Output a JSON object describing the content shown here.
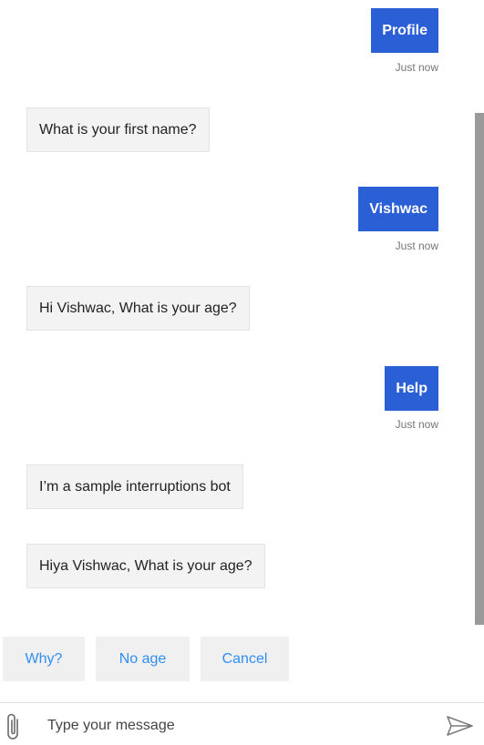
{
  "transcript": {
    "messages": [
      {
        "from": "user",
        "text": "Profile",
        "timestamp": "Just now"
      },
      {
        "from": "bot",
        "text": "What is your first name?"
      },
      {
        "from": "user",
        "text": "Vishwac",
        "timestamp": "Just now"
      },
      {
        "from": "bot",
        "text": "Hi Vishwac, What is your age?"
      },
      {
        "from": "user",
        "text": "Help",
        "timestamp": "Just now"
      },
      {
        "from": "bot",
        "text": "I’m a sample interruptions bot"
      },
      {
        "from": "bot",
        "text": "Hiya Vishwac, What is your age?"
      }
    ]
  },
  "suggested_actions": [
    "Why?",
    "No age",
    "Cancel"
  ],
  "composer": {
    "placeholder": "Type your message",
    "attach_icon": "paperclip-icon",
    "send_icon": "send-icon"
  },
  "colors": {
    "user_bubble": "#2b5fd6",
    "bot_bubble": "#f3f3f3",
    "suggested_text": "#2f8ff5"
  }
}
